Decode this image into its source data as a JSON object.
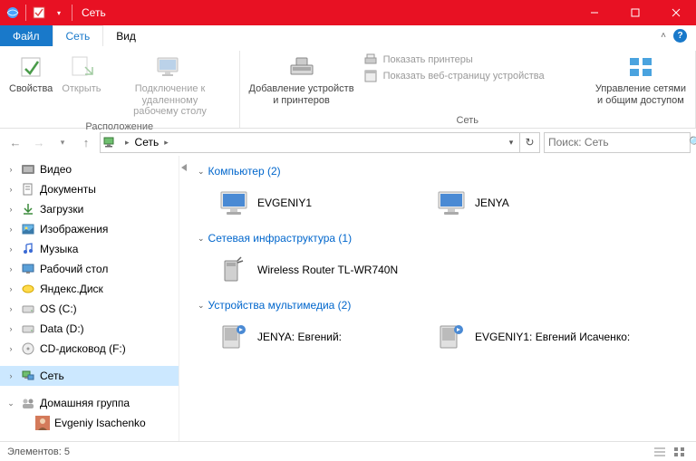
{
  "window": {
    "title": "Сеть",
    "minimize": "—",
    "maximize": "☐",
    "close": "✕"
  },
  "tabs": {
    "file": "Файл",
    "network": "Сеть",
    "view": "Вид"
  },
  "ribbon": {
    "group_location": "Расположение",
    "group_network": "Сеть",
    "properties": "Свойства",
    "open": "Открыть",
    "rdp": "Подключение к удаленному\nрабочему столу",
    "add_devices": "Добавление устройств\nи принтеров",
    "show_printers": "Показать принтеры",
    "show_webpage": "Показать веб-страницу устройства",
    "manage_networks": "Управление сетями\nи общим доступом"
  },
  "nav": {
    "crumb_root": "Сеть",
    "search_placeholder": "Поиск: Сеть"
  },
  "tree": {
    "video": "Видео",
    "documents": "Документы",
    "downloads": "Загрузки",
    "pictures": "Изображения",
    "music": "Музыка",
    "desktop": "Рабочий стол",
    "yadisk": "Яндекс.Диск",
    "os_c": "OS (C:)",
    "data_d": "Data (D:)",
    "cdrom": "CD-дисковод (F:)",
    "network": "Сеть",
    "homegroup": "Домашняя группа",
    "user": "Evgeniy Isachenko"
  },
  "sections": {
    "computer": "Компьютер (2)",
    "infra": "Сетевая инфраструктура (1)",
    "media": "Устройства мультимедиа (2)"
  },
  "items": {
    "comp1": "EVGENIY1",
    "comp2": "JENYA",
    "router": "Wireless Router TL-WR740N",
    "media1": "JENYA: Евгений:",
    "media2": "EVGENIY1: Евгений Исаченко:"
  },
  "status": {
    "count": "Элементов: 5"
  }
}
